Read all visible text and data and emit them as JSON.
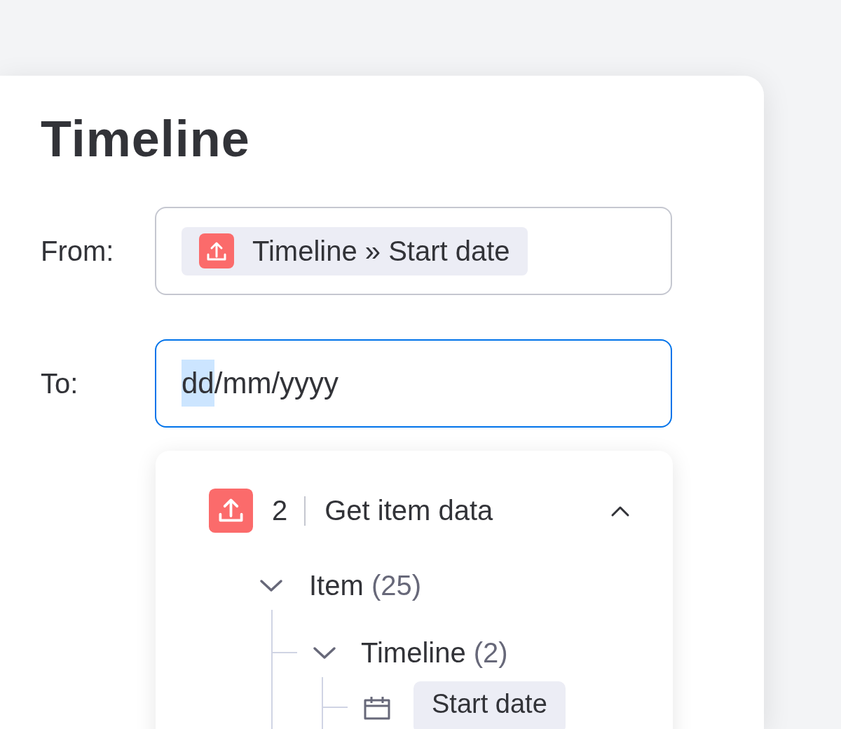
{
  "panel": {
    "title": "Timeline"
  },
  "from": {
    "label": "From:",
    "chip": {
      "text": "Timeline » Start date"
    }
  },
  "to": {
    "label": "To:",
    "focused": true,
    "segments": [
      {
        "text": "dd",
        "selected": true
      },
      {
        "text": "/",
        "selected": false
      },
      {
        "text": "mm",
        "selected": false
      },
      {
        "text": "/",
        "selected": false
      },
      {
        "text": "yyyy",
        "selected": false
      }
    ]
  },
  "dropdown": {
    "group": {
      "number": "2",
      "title": "Get item data",
      "expanded": true
    },
    "tree": [
      {
        "label": "Item",
        "count": "(25)",
        "expanded": true,
        "children": [
          {
            "label": "Timeline",
            "count": "(2)",
            "expanded": true,
            "children": [
              {
                "label": "Start date",
                "kind": "date"
              }
            ]
          }
        ]
      }
    ]
  }
}
